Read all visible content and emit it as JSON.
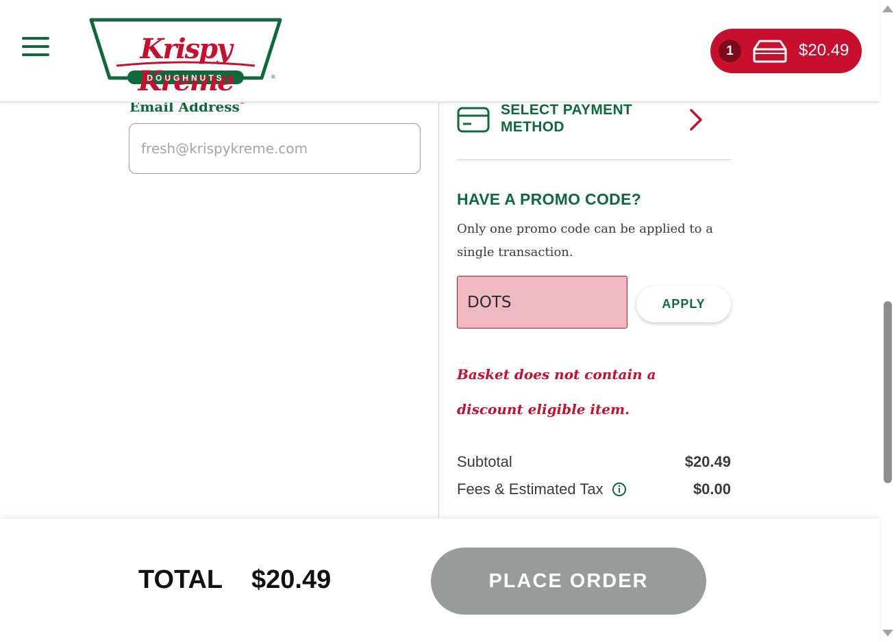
{
  "header": {
    "menu_icon": "hamburger-menu-icon",
    "logo": {
      "wordmark": "Krispy Kreme",
      "subtitle": "DOUGHNUTS",
      "registered": "®"
    },
    "cart": {
      "count": "1",
      "icon": "doughnut-box-icon",
      "total": "$20.49"
    }
  },
  "contact": {
    "email_label": "Email Address",
    "required_mark": "*",
    "email_placeholder": "fresh@krispykreme.com",
    "email_value": ""
  },
  "payment": {
    "icon": "credit-card-icon",
    "label": "SELECT PAYMENT METHOD",
    "chevron_icon": "chevron-right-icon"
  },
  "promo": {
    "title": "HAVE A PROMO CODE?",
    "description": "Only one promo code can be applied to a single transaction.",
    "code_value": "DOTS",
    "apply_label": "APPLY",
    "error": "Basket does not contain a discount eligible item."
  },
  "summary": {
    "subtotal_label": "Subtotal",
    "subtotal_value": "$20.49",
    "fees_label": "Fees & Estimated Tax",
    "fees_info_icon": "info-circle-icon",
    "fees_value": "$0.00"
  },
  "footer": {
    "total_label": "TOTAL",
    "total_value": "$20.49",
    "place_order_label": "PLACE ORDER"
  },
  "colors": {
    "brand_green": "#0e6a3a",
    "brand_red": "#c8102e",
    "error_field_bg": "#f0b9c2",
    "disabled_button": "#999b9a"
  }
}
